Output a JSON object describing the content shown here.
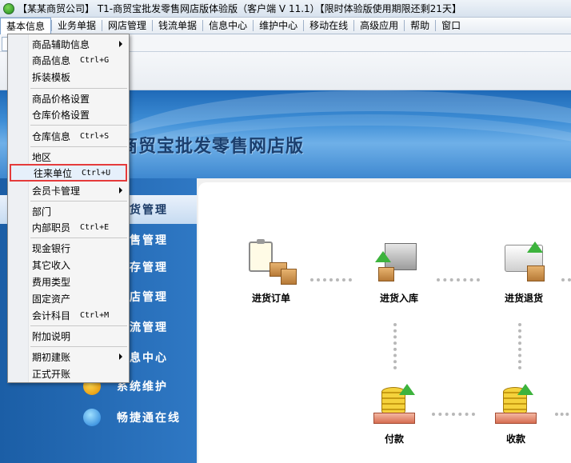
{
  "window": {
    "title": "【某某商贸公司】 T1-商贸宝批发零售网店版体验版（客户端 V 11.1）【限时体验版使用期限还剩21天】"
  },
  "menubar": {
    "items": [
      "基本信息",
      "业务单据",
      "网店管理",
      "钱流单据",
      "信息中心",
      "维护中心",
      "移动在线",
      "高级应用",
      "帮助",
      "窗口"
    ]
  },
  "dropdown": {
    "items": [
      {
        "label": "商品辅助信息",
        "shortcut": "",
        "submenu": true
      },
      {
        "label": "商品信息",
        "shortcut": "Ctrl+G",
        "submenu": false
      },
      {
        "label": "拆装模板",
        "shortcut": "",
        "submenu": false
      },
      {
        "label": "商品价格设置",
        "shortcut": "",
        "submenu": false
      },
      {
        "label": "仓库价格设置",
        "shortcut": "",
        "submenu": false
      },
      {
        "label": "仓库信息",
        "shortcut": "Ctrl+S",
        "submenu": false
      },
      {
        "label": "地区",
        "shortcut": "",
        "submenu": false
      },
      {
        "label": "往来单位",
        "shortcut": "Ctrl+U",
        "submenu": false
      },
      {
        "label": "会员卡管理",
        "shortcut": "",
        "submenu": true
      },
      {
        "label": "部门",
        "shortcut": "",
        "submenu": false
      },
      {
        "label": "内部职员",
        "shortcut": "Ctrl+E",
        "submenu": false
      },
      {
        "label": "现金银行",
        "shortcut": "",
        "submenu": false
      },
      {
        "label": "其它收入",
        "shortcut": "",
        "submenu": false
      },
      {
        "label": "费用类型",
        "shortcut": "",
        "submenu": false
      },
      {
        "label": "固定资产",
        "shortcut": "",
        "submenu": false
      },
      {
        "label": "会计科目",
        "shortcut": "Ctrl+M",
        "submenu": false
      },
      {
        "label": "附加说明",
        "shortcut": "",
        "submenu": false
      },
      {
        "label": "期初建账",
        "shortcut": "",
        "submenu": true
      },
      {
        "label": "正式开账",
        "shortcut": "",
        "submenu": false
      }
    ]
  },
  "banner": {
    "brand_text": "商贸宝批发零售网店版"
  },
  "leftnav": {
    "items": [
      "货管理",
      "售管理",
      "存管理",
      "店管理",
      "流管理",
      "息中心",
      "系统维护",
      "畅捷通在线"
    ]
  },
  "flow": {
    "nodes": [
      "进货订单",
      "进货入库",
      "进货退货",
      "付款",
      "收款"
    ]
  },
  "colors": {
    "nav_blue": "#2f78c4",
    "highlight_border": "#e53b3b"
  }
}
